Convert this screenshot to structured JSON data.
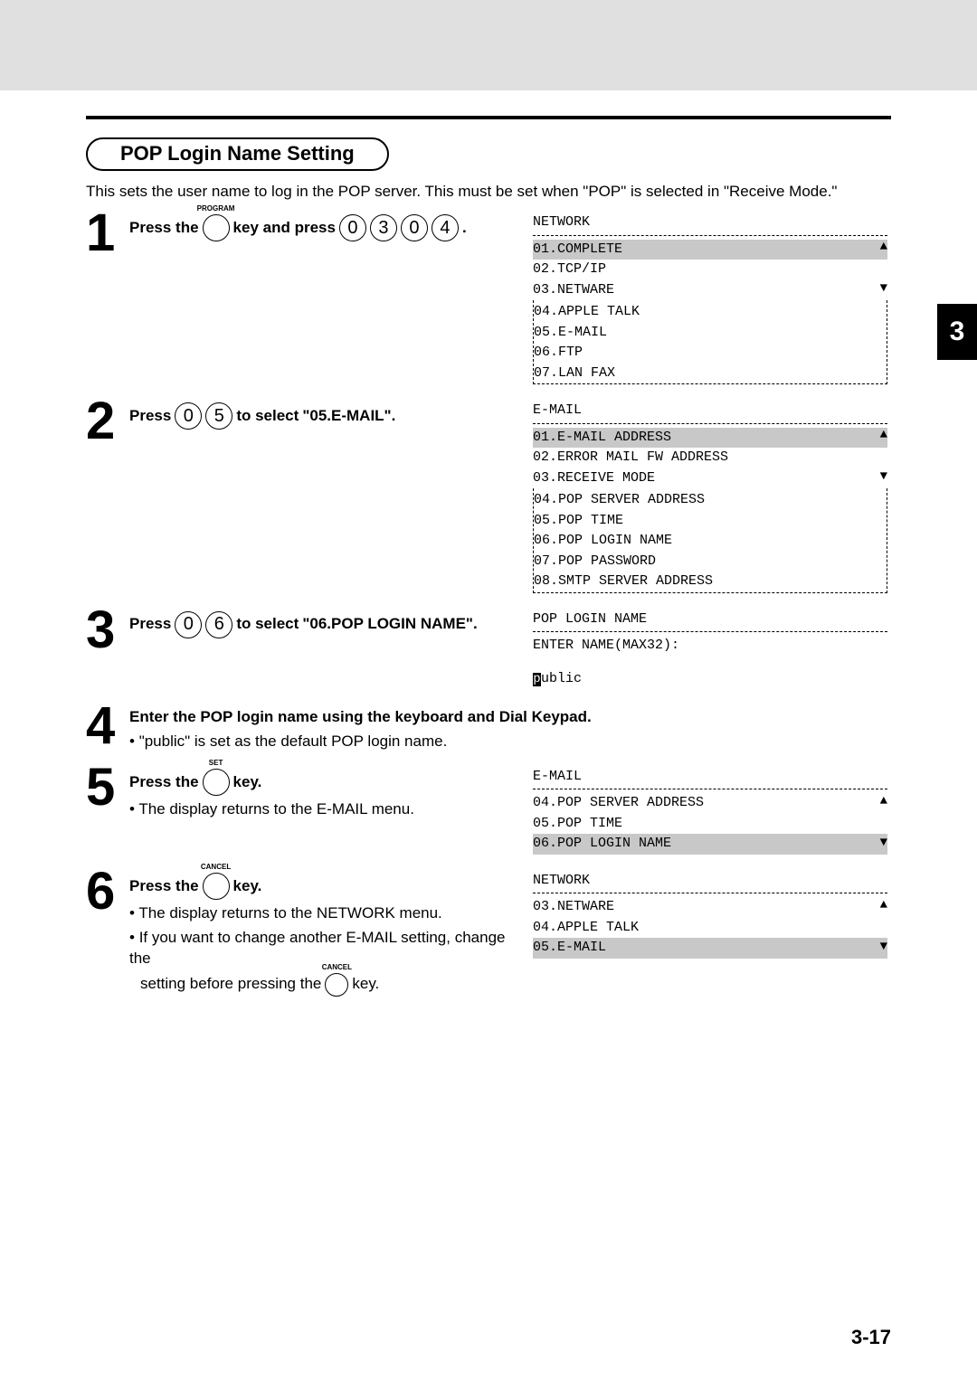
{
  "tabNumber": "3",
  "pageNumber": "3-17",
  "sectionTitle": "POP Login Name Setting",
  "intro": "This sets the user name to log in the POP server. This must be set when \"POP\" is selected in \"Receive Mode.\"",
  "labels": {
    "press": "Press",
    "pressThe": "Press the",
    "keyAndPress": "key and press",
    "key": "key.",
    "toSelect": "to select",
    "dot": ".",
    "program": "PROGRAM",
    "set": "SET",
    "cancel": "CANCEL"
  },
  "step1": {
    "digits": [
      "0",
      "3",
      "0",
      "4"
    ],
    "screenHeader": "NETWORK",
    "rows": [
      {
        "text": "01.COMPLETE",
        "hl": true
      },
      {
        "text": "02.TCP/IP",
        "hl": false
      },
      {
        "text": "03.NETWARE",
        "hl": false
      }
    ],
    "dashedRows": [
      "04.APPLE TALK",
      "05.E-MAIL",
      "06.FTP",
      "07.LAN FAX"
    ]
  },
  "step2": {
    "digits": [
      "0",
      "5"
    ],
    "target": "\"05.E-MAIL\".",
    "screenHeader": "E-MAIL",
    "rows": [
      {
        "text": "01.E-MAIL ADDRESS",
        "hl": true
      },
      {
        "text": "02.ERROR MAIL FW ADDRESS",
        "hl": false
      },
      {
        "text": "03.RECEIVE MODE",
        "hl": false
      }
    ],
    "dashedRows": [
      "04.POP SERVER ADDRESS",
      "05.POP TIME",
      "06.POP LOGIN NAME",
      "07.POP PASSWORD",
      "08.SMTP SERVER ADDRESS"
    ]
  },
  "step3": {
    "digits": [
      "0",
      "6"
    ],
    "target": "\"06.POP LOGIN NAME\".",
    "screenHeader": "POP LOGIN NAME",
    "line2": "ENTER NAME(MAX32):",
    "cursorChar": "p",
    "afterCursor": "ublic"
  },
  "step4": {
    "main": "Enter the POP login name using the keyboard and Dial Keypad.",
    "bullet": "\"public\" is set as the default POP login name."
  },
  "step5": {
    "bullet": "The display returns to the E-MAIL menu.",
    "screenHeader": "E-MAIL",
    "rows": [
      {
        "text": "04.POP SERVER ADDRESS",
        "hl": false
      },
      {
        "text": "05.POP TIME",
        "hl": false
      },
      {
        "text": "06.POP LOGIN NAME",
        "hl": true
      }
    ]
  },
  "step6": {
    "bullet1": "The display returns to the NETWORK menu.",
    "bullet2a": "If you want to change another E-MAIL setting, change the",
    "bullet2b": "setting before pressing the",
    "screenHeader": "NETWORK",
    "rows": [
      {
        "text": "03.NETWARE",
        "hl": false
      },
      {
        "text": "04.APPLE TALK",
        "hl": false
      },
      {
        "text": "05.E-MAIL",
        "hl": true
      }
    ]
  }
}
